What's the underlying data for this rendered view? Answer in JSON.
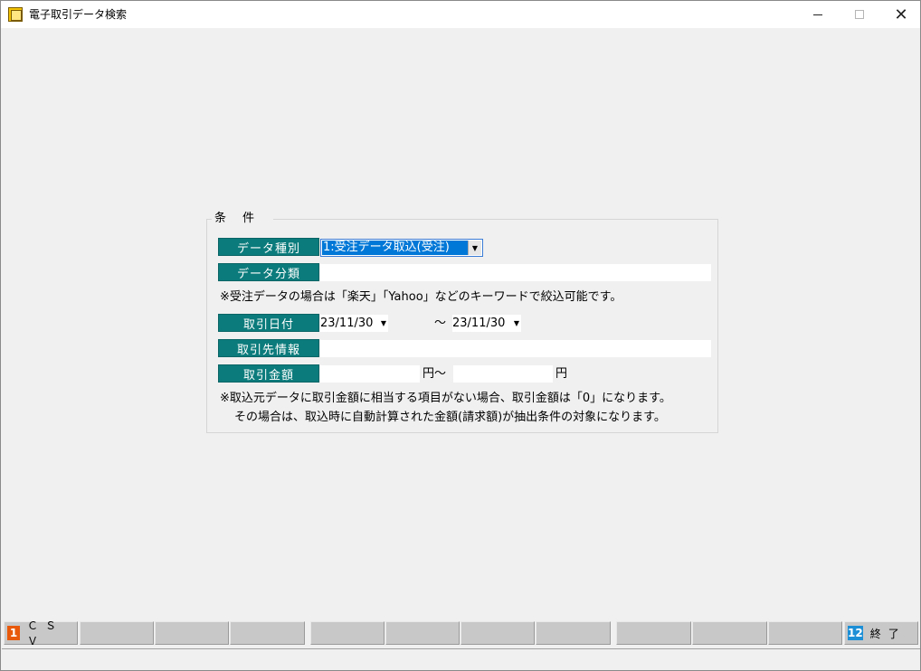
{
  "window": {
    "title": "電子取引データ検索",
    "controls": {
      "minimize": "—",
      "maximize": "□",
      "close": "✕"
    }
  },
  "conditions": {
    "legend": "条件",
    "data_type": {
      "label": "データ種別",
      "value": "1:受注データ取込(受注)"
    },
    "data_class": {
      "label": "データ分類",
      "value": ""
    },
    "note1": "※受注データの場合は「楽天」「Yahoo」などのキーワードで絞込可能です。",
    "trade_date": {
      "label": "取引日付",
      "from": "23/11/30",
      "separator": "〜",
      "to": "23/11/30"
    },
    "partner": {
      "label": "取引先情報",
      "value": ""
    },
    "amount": {
      "label": "取引金額",
      "from": "",
      "to": "",
      "unit_from": "円〜",
      "unit_to": "円"
    },
    "note2": "※取込元データに取引金額に相当する項目がない場合、取引金額は「0」になります。",
    "note3": "その場合は、取込時に自動計算された金額(請求額)が抽出条件の対象になります。"
  },
  "function_keys": [
    {
      "num": "1",
      "label": "ＣＳＶ",
      "color": "#e8590c"
    },
    {
      "num": "",
      "label": ""
    },
    {
      "num": "",
      "label": ""
    },
    {
      "num": "",
      "label": ""
    },
    {
      "num": "",
      "label": ""
    },
    {
      "num": "",
      "label": ""
    },
    {
      "num": "",
      "label": ""
    },
    {
      "num": "",
      "label": ""
    },
    {
      "num": "",
      "label": ""
    },
    {
      "num": "",
      "label": ""
    },
    {
      "num": "",
      "label": ""
    },
    {
      "num": "12",
      "label": "終了",
      "color": "#1c8fd6"
    }
  ],
  "colors": {
    "label_bg": "#0b7b7b",
    "selection": "#0078d7"
  }
}
